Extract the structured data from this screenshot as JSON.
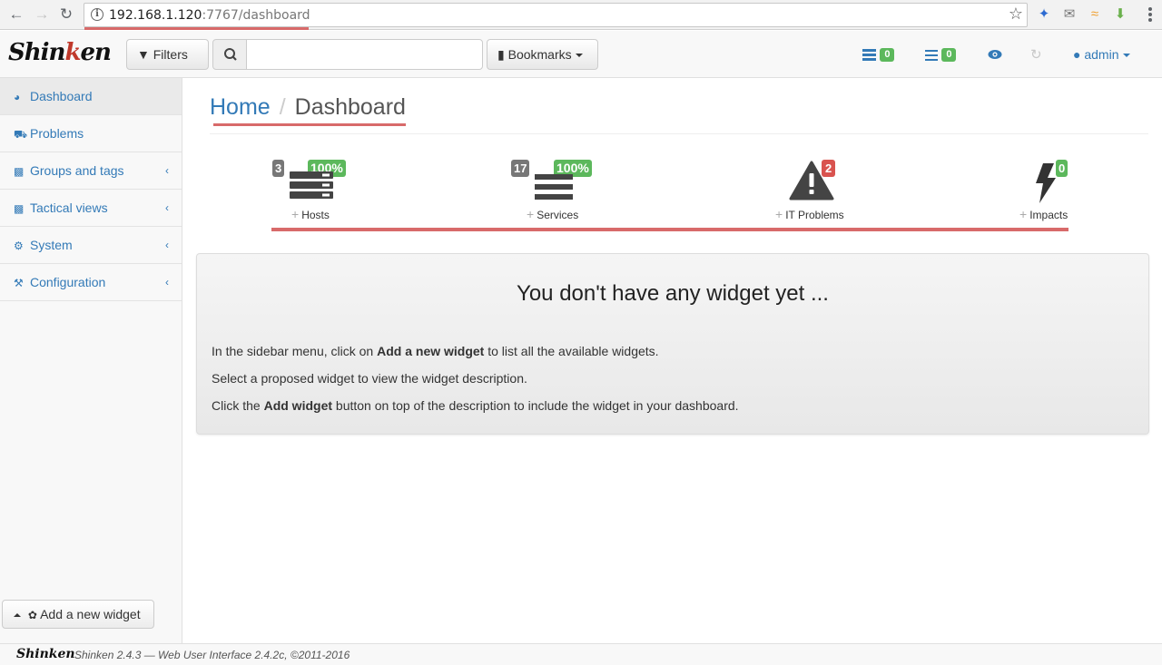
{
  "browser": {
    "url_host": "192.168.1.120",
    "url_rest": ":7767/dashboard"
  },
  "navbar": {
    "brand": "Shinken",
    "filters_label": "Filters",
    "search_placeholder": "",
    "bookmarks_label": "Bookmarks",
    "hosts_problems_count": "0",
    "services_problems_count": "0",
    "user_label": "admin"
  },
  "sidebar": {
    "items": [
      {
        "label": "Dashboard",
        "icon": "dashboard-icon"
      },
      {
        "label": "Problems",
        "icon": "ambulance-icon"
      },
      {
        "label": "Groups and tags",
        "icon": "sitemap-icon"
      },
      {
        "label": "Tactical views",
        "icon": "bar-chart-icon"
      },
      {
        "label": "System",
        "icon": "gears-icon"
      },
      {
        "label": "Configuration",
        "icon": "wrench-icon"
      }
    ],
    "add_widget_label": "Add a new widget"
  },
  "breadcrumb": {
    "home": "Home",
    "separator": "/",
    "current": "Dashboard"
  },
  "summary": {
    "hosts": {
      "count": "3",
      "percent": "100%",
      "label": "Hosts"
    },
    "services": {
      "count": "17",
      "percent": "100%",
      "label": "Services"
    },
    "problems": {
      "count": "2",
      "label": "IT Problems"
    },
    "impacts": {
      "count": "0",
      "label": "Impacts"
    }
  },
  "panel": {
    "title": "You don't have any widget yet ...",
    "line1_pre": "In the sidebar menu, click on ",
    "line1_bold": "Add a new widget",
    "line1_post": " to list all the available widgets.",
    "line2": "Select a proposed widget to view the widget description.",
    "line3_pre": "Click the ",
    "line3_bold": "Add widget",
    "line3_post": " button on top of the description to include the widget in your dashboard."
  },
  "footer": {
    "logo": "Shinken",
    "text": "Shinken 2.4.3 — Web User Interface 2.4.2c, ©2011-2016"
  },
  "colors": {
    "link": "#337ab7",
    "ok": "#5cb85c",
    "critical": "#d9534f",
    "highlight": "#d86a6a"
  }
}
